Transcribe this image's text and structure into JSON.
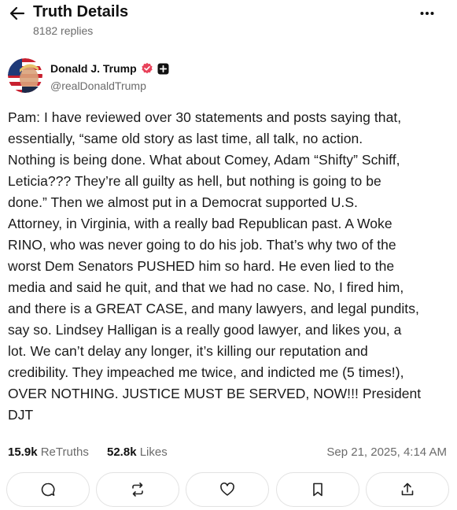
{
  "header": {
    "title": "Truth Details",
    "replies": "8182 replies"
  },
  "author": {
    "name": "Donald J. Trump",
    "handle": "@realDonaldTrump"
  },
  "post": {
    "lines": [
      "Pam: I have reviewed over 30 statements and posts saying that,",
      "essentially, “same old story as last time, all talk, no action.",
      "Nothing is being done. What about Comey, Adam “Shifty” Schiff,",
      "Leticia??? They’re all guilty as hell, but nothing is going to be",
      "done.” Then we almost put in a Democrat supported U.S.",
      "Attorney, in Virginia, with a really bad Republican past. A Woke",
      "RINO, who was never going to do his job. That’s why two of the",
      "worst Dem Senators PUSHED him so hard. He even lied to the",
      "media and said he quit, and that we had no case. No, I fired him,",
      "and there is a GREAT CASE, and many lawyers, and legal pundits,",
      "say so. Lindsey Halligan is a really good lawyer, and likes you, a",
      "lot. We can’t delay any longer, it’s killing our reputation and",
      "credibility. They impeached me twice, and indicted me (5 times!),",
      "OVER NOTHING. JUSTICE MUST BE SERVED, NOW!!! President",
      "DJT"
    ]
  },
  "stats": {
    "retruths_count": "15.9k",
    "retruths_label": "ReTruths",
    "likes_count": "52.8k",
    "likes_label": "Likes",
    "timestamp": "Sep 21, 2025, 4:14 AM"
  },
  "icons": {
    "back": "arrow-left-icon",
    "more": "more-horizontal-icon",
    "verified": "verified-badge-icon",
    "plus": "plus-badge-icon",
    "reply": "reply-bubble-icon",
    "retruth": "retruth-arrows-icon",
    "like": "heart-icon",
    "bookmark": "bookmark-icon",
    "share": "share-upload-icon"
  },
  "colors": {
    "verified": "#E8425A",
    "muted_text": "#6b6b6b",
    "border": "#e2e2e2"
  }
}
